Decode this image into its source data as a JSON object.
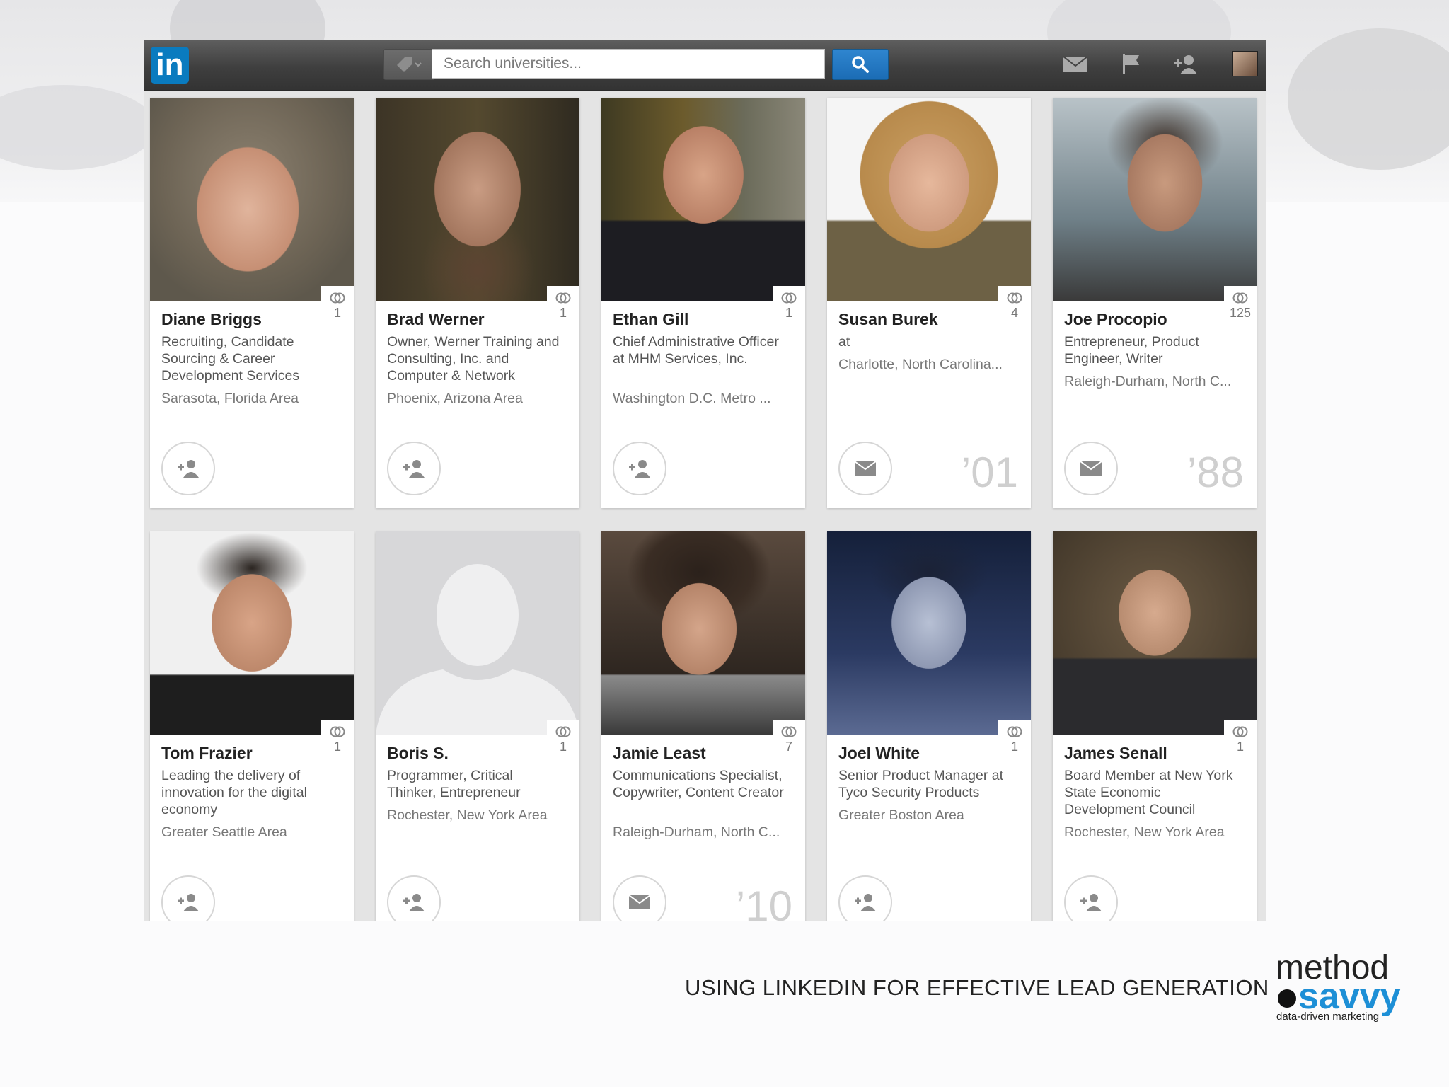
{
  "app": {
    "logo_text": "in"
  },
  "search": {
    "placeholder": "Search universities..."
  },
  "nav": {
    "icons": [
      "mail-icon",
      "flag-icon",
      "add-connection-icon"
    ]
  },
  "cards": [
    {
      "name": "Diane Briggs",
      "headline": "Recruiting, Candidate Sourcing & Career Development Services",
      "location": "Sarasota, Florida Area",
      "connections": "1",
      "action": "connect",
      "year": ""
    },
    {
      "name": "Brad Werner",
      "headline": "Owner, Werner Training and Consulting, Inc. and Computer & Network",
      "location": "Phoenix, Arizona Area",
      "connections": "1",
      "action": "connect",
      "year": ""
    },
    {
      "name": "Ethan Gill",
      "headline": "Chief Administrative Officer at MHM Services, Inc.",
      "location": "Washington D.C. Metro ...",
      "connections": "1",
      "action": "connect",
      "year": ""
    },
    {
      "name": "Susan Burek",
      "headline": "at",
      "location": "Charlotte, North Carolina...",
      "connections": "4",
      "action": "message",
      "year": "’01"
    },
    {
      "name": "Joe Procopio",
      "headline": "Entrepreneur, Product Engineer, Writer",
      "location": "Raleigh-Durham, North C...",
      "connections": "125",
      "action": "message",
      "year": "’88"
    },
    {
      "name": "Tom Frazier",
      "headline": "Leading the delivery of innovation for the digital economy",
      "location": "Greater Seattle Area",
      "connections": "1",
      "action": "connect",
      "year": ""
    },
    {
      "name": "Boris S.",
      "headline": "Programmer, Critical Thinker, Entrepreneur",
      "location": "Rochester, New York Area",
      "connections": "1",
      "action": "connect",
      "year": ""
    },
    {
      "name": "Jamie Least",
      "headline": "Communications Specialist, Copywriter, Content Creator",
      "location": "Raleigh-Durham, North C...",
      "connections": "7",
      "action": "message",
      "year": "’10"
    },
    {
      "name": "Joel White",
      "headline": "Senior Product Manager at Tyco Security Products",
      "location": "Greater Boston Area",
      "connections": "1",
      "action": "connect",
      "year": ""
    },
    {
      "name": "James Senall",
      "headline": "Board Member at New York State Economic Development Council",
      "location": "Rochester, New York Area",
      "connections": "1",
      "action": "connect",
      "year": ""
    }
  ],
  "slide": {
    "caption": "USING LINKEDIN FOR EFFECTIVE LEAD GENERATION",
    "brand_top": "method",
    "brand_bottom": "savvy",
    "brand_tagline": "data-driven marketing"
  },
  "colors": {
    "linkedin_blue": "#0a7bbf",
    "search_button": "#1f74bd",
    "brand_blue": "#1d8fd6"
  }
}
